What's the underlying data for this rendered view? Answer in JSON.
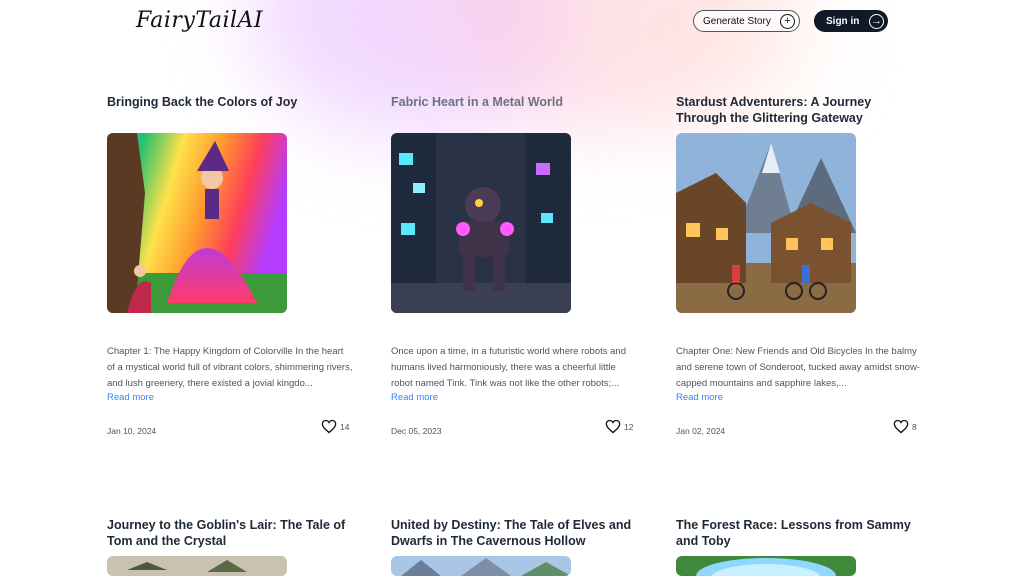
{
  "header": {
    "logo": "FairyTailAI",
    "generate_label": "Generate Story",
    "signin_label": "Sign in"
  },
  "stories": [
    {
      "title": "Bringing Back the Colors of Joy",
      "excerpt": "Chapter 1: The Happy Kingdom of Colorville In the heart of a mystical world full of vibrant colors, shimmering rivers, and lush greenery, there existed a jovial kingdo...",
      "read_more": "Read more",
      "date": "Jan 10, 2024",
      "likes": "14"
    },
    {
      "title": "Fabric Heart in a Metal World",
      "excerpt": "Once upon a time, in a futuristic world where robots and humans lived harmoniously, there was a cheerful little robot named Tink. Tink was not like the other robots;...",
      "read_more": "Read more",
      "date": "Dec 05, 2023",
      "likes": "12"
    },
    {
      "title": "Stardust Adventurers: A Journey Through the Glittering Gateway",
      "excerpt": "Chapter One: New Friends and Old Bicycles In the balmy and serene town of Sonderoot, tucked away amidst snow-capped mountains and sapphire lakes,...",
      "read_more": "Read more",
      "date": "Jan 02, 2024",
      "likes": "8"
    },
    {
      "title": "Journey to the Goblin's Lair: The Tale of Tom and the Crystal"
    },
    {
      "title": "United by Destiny: The Tale of Elves and Dwarfs in The Cavernous Hollow"
    },
    {
      "title": "The Forest Race: Lessons from Sammy and Toby"
    }
  ]
}
